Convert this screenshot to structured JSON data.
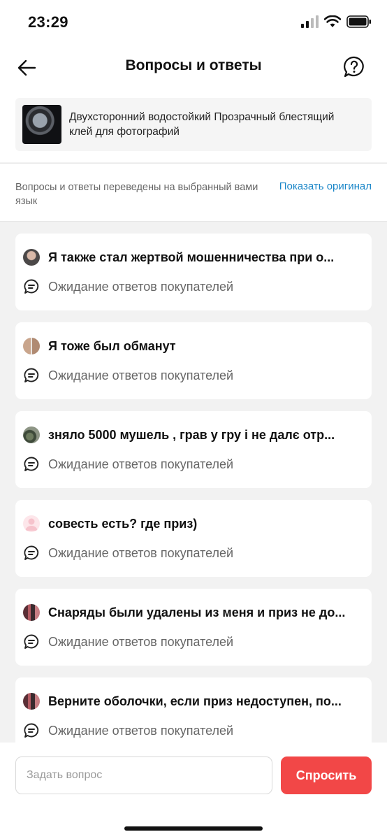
{
  "status_bar": {
    "time": "23:29"
  },
  "header": {
    "title": "Вопросы и ответы"
  },
  "product": {
    "title": "Двухсторонний водостойкий Прозрачный блестящий клей для фотографий"
  },
  "notice": {
    "text": "Вопросы и ответы переведены на выбранный вами язык",
    "link": "Показать оригинал"
  },
  "questions": [
    {
      "question": "Я также стал жертвой мошенничества при о...",
      "answer": "Ожидание ответов покупателей"
    },
    {
      "question": "Я тоже был обманут",
      "answer": "Ожидание ответов покупателей"
    },
    {
      "question": "зняло 5000 мушель , грав у гру і не далє отр...",
      "answer": "Ожидание ответов покупателей"
    },
    {
      "question": "совесть есть? где приз)",
      "answer": "Ожидание ответов покупателей"
    },
    {
      "question": "Снаряды были удалены из меня и приз не до...",
      "answer": "Ожидание ответов покупателей"
    },
    {
      "question": "Верните оболочки, если приз недоступен, по...",
      "answer": "Ожидание ответов покупателей"
    }
  ],
  "bottom": {
    "input_placeholder": "Задать вопрос",
    "ask_label": "Спросить"
  },
  "colors": {
    "accent": "#f24747",
    "link": "#1a86c8"
  },
  "icons": [
    "back-arrow-icon",
    "question-bubble-icon",
    "chat-bubble-icon",
    "signal-icon",
    "wifi-icon",
    "battery-icon"
  ]
}
